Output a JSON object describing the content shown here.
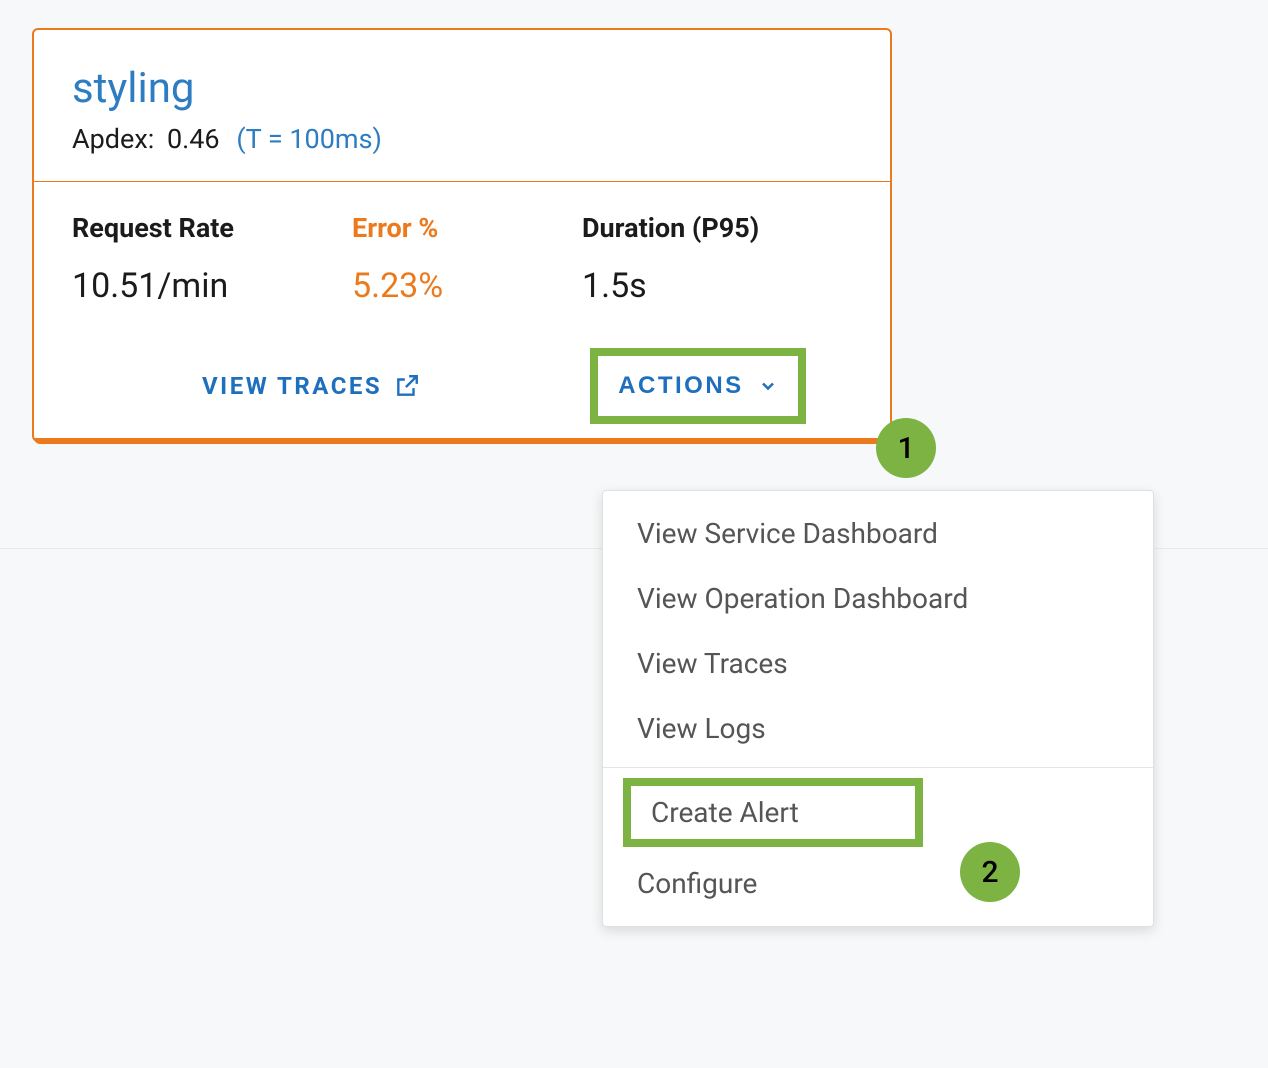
{
  "service": {
    "name": "styling",
    "apdex_label": "Apdex:",
    "apdex_value": "0.46",
    "apdex_threshold": "(T = 100ms)"
  },
  "metrics": {
    "request_rate": {
      "label": "Request Rate",
      "value": "10.51/min"
    },
    "error_pct": {
      "label": "Error %",
      "value": "5.23%"
    },
    "duration_p95": {
      "label": "Duration (P95)",
      "value": "1.5s"
    }
  },
  "buttons": {
    "view_traces": "VIEW TRACES",
    "actions": "ACTIONS"
  },
  "dropdown": {
    "items": [
      "View Service Dashboard",
      "View Operation Dashboard",
      "View Traces",
      "View Logs"
    ],
    "create_alert": "Create Alert",
    "configure": "Configure"
  },
  "annotations": {
    "step1": "1",
    "step2": "2"
  },
  "colors": {
    "accent_orange": "#EC7A1C",
    "link_blue": "#1F6FBF",
    "highlight_green": "#7CB342"
  }
}
